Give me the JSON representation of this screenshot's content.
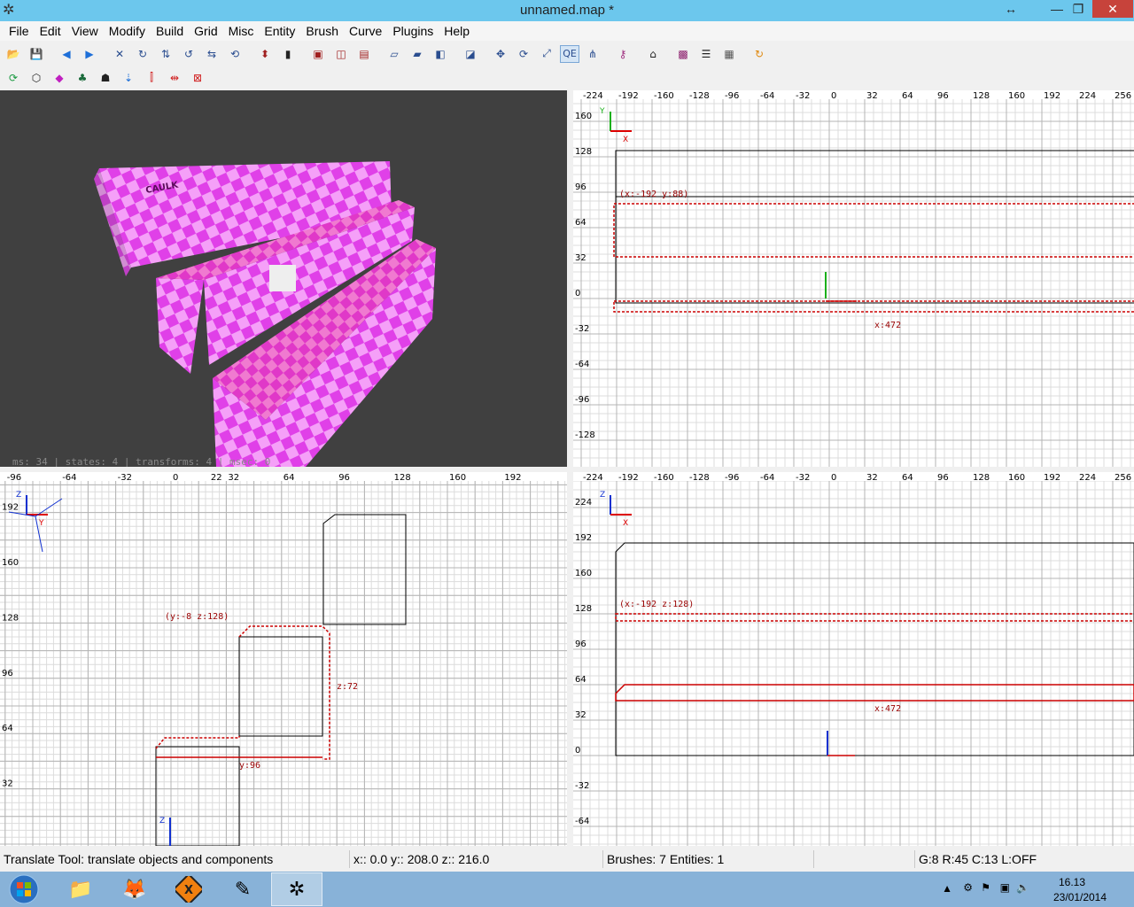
{
  "window": {
    "title": "unnamed.map *",
    "app_icon": "radiant-icon"
  },
  "menu": [
    "File",
    "Edit",
    "View",
    "Modify",
    "Build",
    "Grid",
    "Misc",
    "Entity",
    "Brush",
    "Curve",
    "Plugins",
    "Help"
  ],
  "toolbar1": {
    "qe_label": "QE"
  },
  "camera": {
    "status": "ms: 34 | states: 4 | transforms: 4 | msec: 0",
    "texture_label": "CAULK"
  },
  "view_top": {
    "x_ticks": [
      "-224",
      "-192",
      "-160",
      "-128",
      "-96",
      "-64",
      "-32",
      "0",
      "32",
      "64",
      "96",
      "128",
      "160",
      "192",
      "224",
      "256"
    ],
    "y_ticks": [
      "160",
      "128",
      "96",
      "64",
      "32",
      "0",
      "-32",
      "-64",
      "-96",
      "-128"
    ],
    "axis_h": "X",
    "axis_v": "Y",
    "coord_label": "(x:-192  y:88)",
    "size_label": "x:472"
  },
  "view_side": {
    "x_ticks": [
      "-96",
      "-64",
      "-32",
      "0",
      "32",
      "64",
      "96",
      "128",
      "160",
      "192",
      "22"
    ],
    "y_ticks": [
      "192",
      "160",
      "128",
      "96",
      "64",
      "32"
    ],
    "axis_h": "Y",
    "axis_v": "Z",
    "coord_label": "(y:-8  z:128)",
    "size_z": "z:72",
    "size_y": "y:96"
  },
  "view_front": {
    "x_ticks": [
      "-224",
      "-192",
      "-160",
      "-128",
      "-96",
      "-64",
      "-32",
      "0",
      "32",
      "64",
      "96",
      "128",
      "160",
      "192",
      "224",
      "256"
    ],
    "y_ticks": [
      "224",
      "192",
      "160",
      "128",
      "96",
      "64",
      "32",
      "0",
      "-32",
      "-64"
    ],
    "axis_h": "X",
    "axis_v": "Z",
    "coord_label": "(x:-192  z:128)",
    "size_label": "x:472"
  },
  "status": {
    "tool": "Translate Tool: translate objects and components",
    "coords": "x::    0.0  y::  208.0  z::  216.0",
    "counts": "Brushes: 7 Entities: 1",
    "grid": "G:8  R:45  C:13  L:OFF"
  },
  "taskbar": {
    "time": "16.13",
    "date": "23/01/2014"
  },
  "colors": {
    "caulk_pink": "#e040e8",
    "caulk_light": "#f090f5",
    "selection": "#c00000",
    "titlebar": "#6cc7ed"
  }
}
